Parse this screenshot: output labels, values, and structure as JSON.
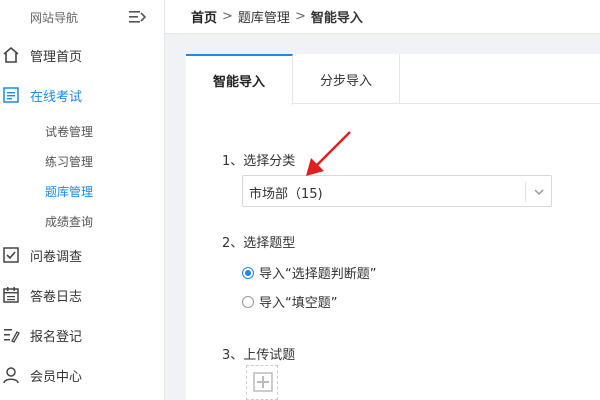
{
  "sidebar": {
    "brand": "网站导航",
    "items": [
      {
        "label": "管理首页",
        "icon": "home-icon"
      },
      {
        "label": "在线考试",
        "icon": "list-icon",
        "active": true,
        "children": [
          {
            "label": "试卷管理"
          },
          {
            "label": "练习管理"
          },
          {
            "label": "题库管理",
            "active": true
          },
          {
            "label": "成绩查询"
          }
        ]
      },
      {
        "label": "问卷调查",
        "icon": "checkbox-icon"
      },
      {
        "label": "答卷日志",
        "icon": "calendar-icon"
      },
      {
        "label": "报名登记",
        "icon": "edit-list-icon"
      },
      {
        "label": "会员中心",
        "icon": "user-icon"
      }
    ]
  },
  "breadcrumb": {
    "home": "首页",
    "sep": ">",
    "level1": "题库管理",
    "current": "智能导入"
  },
  "tabs": [
    {
      "label": "智能导入",
      "active": true
    },
    {
      "label": "分步导入",
      "active": false
    }
  ],
  "form": {
    "step1_label": "1、选择分类",
    "category_value": "市场部（15)",
    "step2_label": "2、选择题型",
    "radio_options": [
      {
        "label": "导入“选择题判断题”",
        "checked": true
      },
      {
        "label": "导入“填空题”",
        "checked": false
      }
    ],
    "step3_label": "3、上传试题"
  },
  "colors": {
    "accent": "#1e88e5",
    "annotation_arrow": "#e02020"
  }
}
